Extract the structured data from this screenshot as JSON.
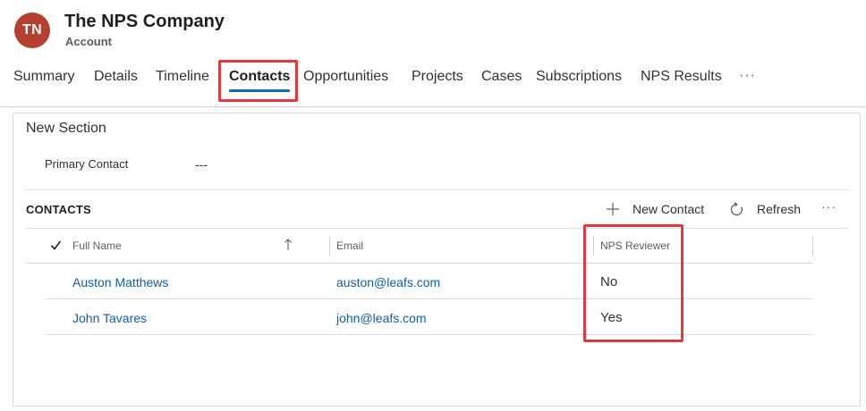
{
  "record": {
    "initials": "TN",
    "name": "The NPS Company",
    "entity": "Account"
  },
  "tabs": [
    {
      "label": "Summary"
    },
    {
      "label": "Details"
    },
    {
      "label": "Timeline"
    },
    {
      "label": "Contacts"
    },
    {
      "label": "Opportunities"
    },
    {
      "label": "Projects"
    },
    {
      "label": "Cases"
    },
    {
      "label": "Subscriptions"
    },
    {
      "label": "NPS Results"
    }
  ],
  "tabs_more": "···",
  "active_tab": "Contacts",
  "section": {
    "title": "New Section",
    "field_label": "Primary Contact",
    "field_value": "---"
  },
  "subgrid": {
    "title": "CONTACTS",
    "new_label": "New Contact",
    "refresh_label": "Refresh",
    "more": "···",
    "columns": [
      "Full Name",
      "Email",
      "NPS Reviewer"
    ],
    "rows": [
      {
        "full_name": "Auston Matthews",
        "email": "auston@leafs.com",
        "nps_reviewer": "No"
      },
      {
        "full_name": "John Tavares",
        "email": "john@leafs.com",
        "nps_reviewer": "Yes"
      }
    ]
  },
  "colors": {
    "avatar_bg": "#b5402f",
    "accent": "#0f6cbd",
    "link": "#115ea3",
    "highlight": "#e0393e"
  },
  "icons": [
    "plus-icon",
    "refresh-icon",
    "checkmark-icon",
    "sort-ascending-icon",
    "more-icon"
  ]
}
